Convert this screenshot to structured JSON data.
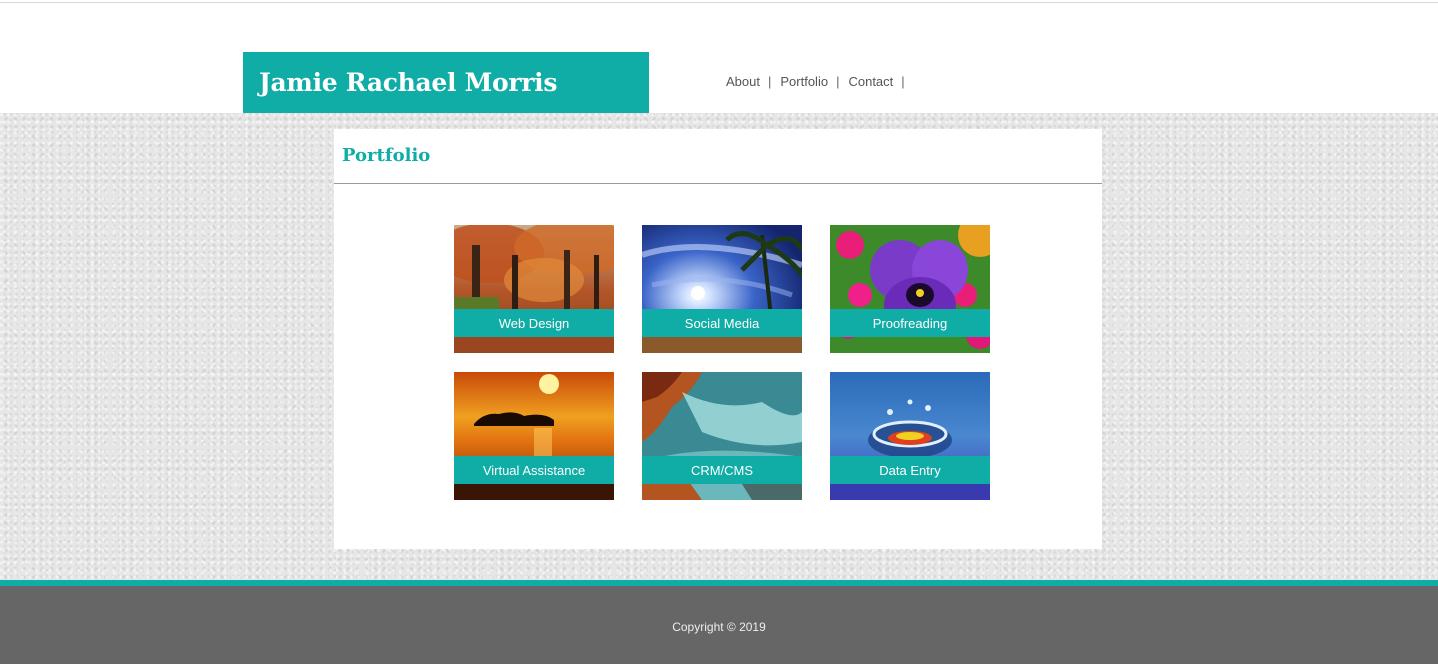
{
  "header": {
    "site_title": "Jamie Rachael Morris",
    "nav": [
      {
        "label": "About"
      },
      {
        "label": "Portfolio"
      },
      {
        "label": "Contact"
      }
    ],
    "separator": "|"
  },
  "main": {
    "heading": "Portfolio",
    "tiles": [
      {
        "label": "Web Design",
        "image": "autumn-tree-avenue"
      },
      {
        "label": "Social Media",
        "image": "sun-sky-palm-tree"
      },
      {
        "label": "Proofreading",
        "image": "purple-pansy-flowers"
      },
      {
        "label": "Virtual Assistance",
        "image": "orange-sunset-island"
      },
      {
        "label": "CRM/CMS",
        "image": "rocky-coast-waves"
      },
      {
        "label": "Data Entry",
        "image": "water-droplet-splash"
      }
    ]
  },
  "footer": {
    "copyright": "Copyright © 2019"
  },
  "colors": {
    "accent": "#0fada5",
    "footer": "#666666",
    "background": "#e6e6e6"
  }
}
